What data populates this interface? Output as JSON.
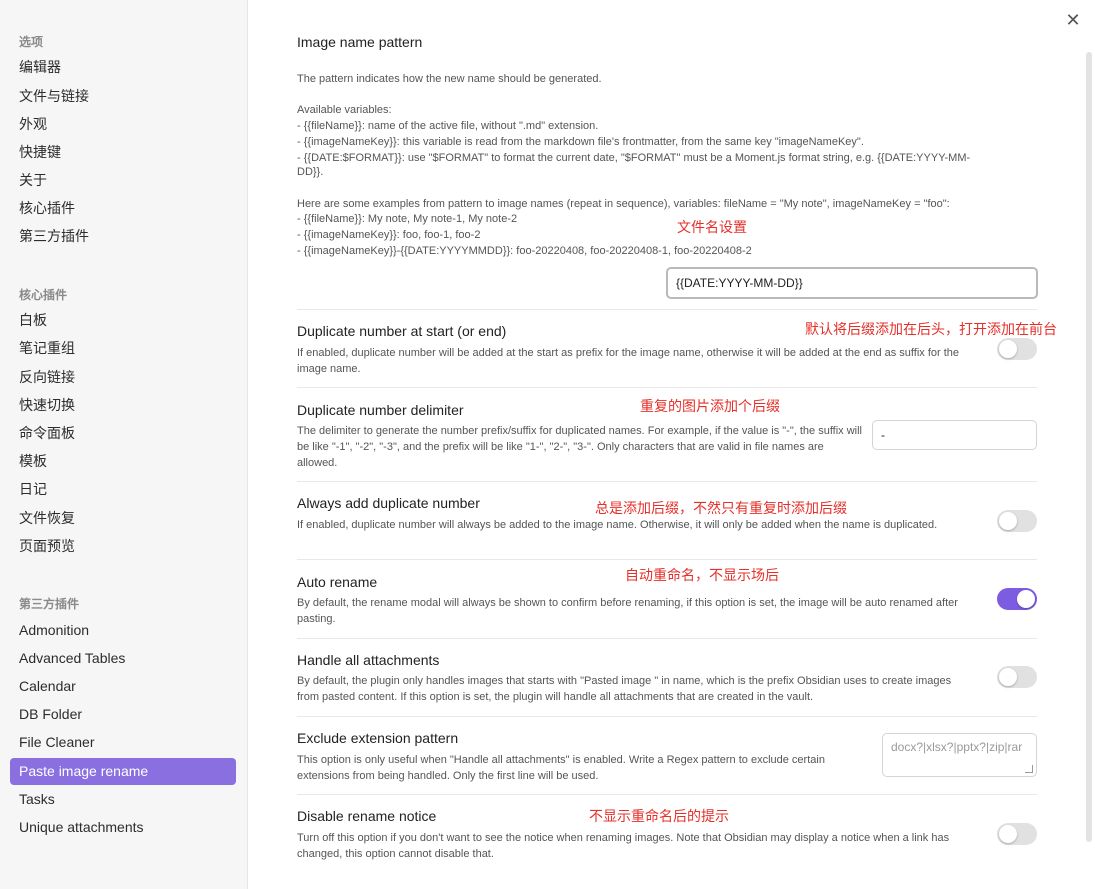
{
  "sidebar": {
    "groups": [
      {
        "title": "选项",
        "items": [
          "编辑器",
          "文件与链接",
          "外观",
          "快捷键",
          "关于",
          "核心插件",
          "第三方插件"
        ]
      },
      {
        "title": "核心插件",
        "items": [
          "白板",
          "笔记重组",
          "反向链接",
          "快速切换",
          "命令面板",
          "模板",
          "日记",
          "文件恢复",
          "页面预览"
        ]
      },
      {
        "title": "第三方插件",
        "items": [
          "Admonition",
          "Advanced Tables",
          "Calendar",
          "DB Folder",
          "File Cleaner",
          "Paste image rename",
          "Tasks",
          "Unique attachments"
        ]
      }
    ],
    "active_item": "Paste image rename"
  },
  "modal": {
    "close_symbol": "✕"
  },
  "pattern": {
    "title": "Image name pattern",
    "lines": [
      "The pattern indicates how the new name should be generated.",
      "",
      "Available variables:",
      "- {{fileName}}: name of the active file, without \".md\" extension.",
      "- {{imageNameKey}}: this variable is read from the markdown file's frontmatter, from the same key \"imageNameKey\".",
      "- {{DATE:$FORMAT}}: use \"$FORMAT\" to format the current date, \"$FORMAT\" must be a Moment.js format string, e.g. {{DATE:YYYY-MM-",
      "DD}}.",
      "",
      "Here are some examples from pattern to image names (repeat in sequence), variables: fileName = \"My note\", imageNameKey = \"foo\":",
      "- {{fileName}}: My note, My note-1, My note-2",
      "- {{imageNameKey}}: foo, foo-1, foo-2",
      "- {{imageNameKey}}-{{DATE:YYYYMMDD}}: foo-20220408, foo-20220408-1, foo-20220408-2"
    ],
    "value": "{{DATE:YYYY-MM-DD}}",
    "annotation": "文件名设置"
  },
  "settings": {
    "dup_start": {
      "title": "Duplicate number at start (or end)",
      "desc": "If enabled, duplicate number will be added at the start as prefix for the image name, otherwise it will be added at the end as suffix for the image name.",
      "enabled": false,
      "annotation": "默认将后缀添加在后头，打开添加在前台"
    },
    "delimiter": {
      "title": "Duplicate number delimiter",
      "desc": "The delimiter to generate the number prefix/suffix for duplicated names. For example, if the value is \"-\", the suffix will be like \"-1\", \"-2\", \"-3\", and the prefix will be like \"1-\", \"2-\", \"3-\". Only characters that are valid in file names are allowed.",
      "value": "-",
      "annotation": "重复的图片添加个后缀"
    },
    "always_add": {
      "title": "Always add duplicate number",
      "desc": "If enabled, duplicate number will always be added to the image name. Otherwise, it will only be added when the name is duplicated.",
      "enabled": false,
      "annotation": "总是添加后缀，不然只有重复时添加后缀"
    },
    "auto_rename": {
      "title": "Auto rename",
      "desc": "By default, the rename modal will always be shown to confirm before renaming, if this option is set, the image will be auto renamed after pasting.",
      "enabled": true,
      "annotation": "自动重命名，不显示场后"
    },
    "handle_all": {
      "title": "Handle all attachments",
      "desc": "By default, the plugin only handles images that starts with \"Pasted image \" in name, which is the prefix Obsidian uses to create images from pasted content. If this option is set, the plugin will handle all attachments that are created in the vault.",
      "enabled": false
    },
    "exclude": {
      "title": "Exclude extension pattern",
      "desc": "This option is only useful when \"Handle all attachments\" is enabled. Write a Regex pattern to exclude certain extensions from being handled. Only the first line will be used.",
      "placeholder": "docx?|xlsx?|pptx?|zip|rar"
    },
    "disable_notice": {
      "title": "Disable rename notice",
      "desc": "Turn off this option if you don't want to see the notice when renaming images. Note that Obsidian may display a notice when a link has changed, this option cannot disable that.",
      "enabled": false,
      "annotation": "不显示重命名后的提示"
    }
  },
  "colors": {
    "accent": "#7c5ce0",
    "active_item": "#8a6fe0",
    "annotation": "#e5302a"
  }
}
